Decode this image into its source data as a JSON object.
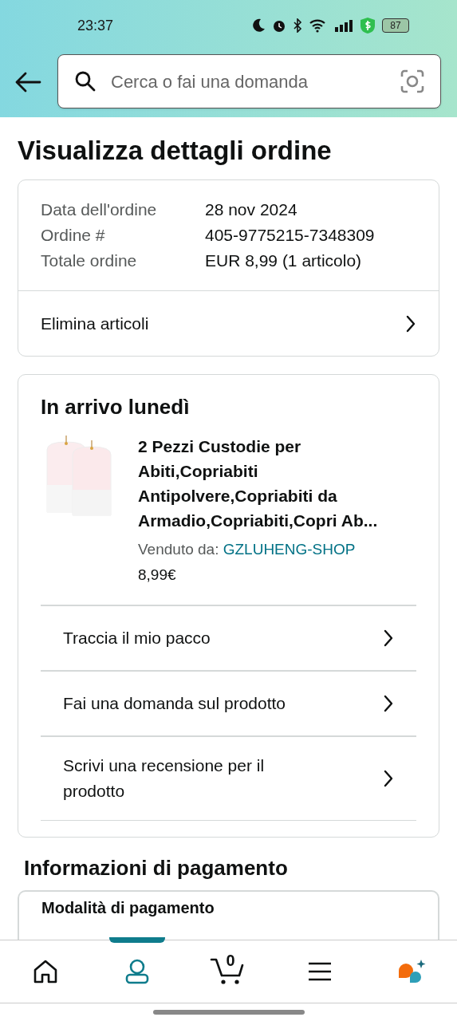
{
  "status_bar": {
    "time": "23:37",
    "battery": "87"
  },
  "search": {
    "placeholder": "Cerca o fai una domanda"
  },
  "title": "Visualizza dettagli ordine",
  "order_summary": {
    "rows": [
      {
        "label": "Data dell'ordine",
        "value": "28 nov 2024"
      },
      {
        "label": "Ordine #",
        "value": "405-9775215-7348309"
      },
      {
        "label": "Totale ordine",
        "value": "EUR 8,99 (1 articolo)"
      }
    ],
    "action": "Elimina articoli"
  },
  "shipment": {
    "heading": "In arrivo lunedì",
    "product": {
      "kind": "picture",
      "name": "2 Pezzi Custodie per Abiti,Copriabiti Antipolvere,Copriabiti da Armadio,Copriabiti,Copri Ab...",
      "sold_by_label": "Venduto da:",
      "seller": "GZLUHENG-SHOP",
      "price": "8,99€"
    },
    "actions": [
      "Traccia il mio pacco",
      "Fai una domanda sul prodotto",
      "Scrivi una recensione per il prodotto"
    ]
  },
  "payment": {
    "heading": "Informazioni di pagamento",
    "card_title": "Modalità di pagamento"
  },
  "bottom_nav": [
    {
      "kind": "home",
      "selected": false
    },
    {
      "kind": "account",
      "selected": true
    },
    {
      "kind": "cart",
      "selected": false,
      "count": "0"
    },
    {
      "kind": "menu",
      "selected": false
    },
    {
      "kind": "assistant",
      "selected": false
    }
  ]
}
